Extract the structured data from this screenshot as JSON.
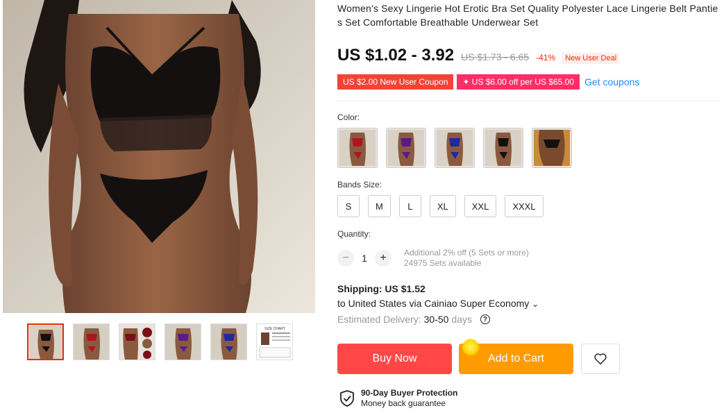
{
  "product": {
    "title": "Women's Sexy Lingerie Hot Erotic Bra Set Quality Polyester Lace Lingerie Belt Panties Set Comfortable Breathable Underwear Set"
  },
  "gallery": {
    "thumbnail_count": 6,
    "active_index": 0,
    "size_chart_label": "SIZE CHART"
  },
  "price": {
    "current": "US $1.02 - 3.92",
    "original": "US $1.73 - 6.65",
    "discount": "-41%",
    "deal_badge": "New User Deal"
  },
  "coupons": {
    "coupon1": "US $2.00 New User Coupon",
    "coupon2": "✦ US $6.00 off per US $65.00",
    "get_link": "Get coupons"
  },
  "color": {
    "label": "Color:",
    "swatches": [
      "red",
      "purple",
      "blue",
      "black",
      "photo"
    ]
  },
  "size": {
    "label": "Bands Size:",
    "options": [
      "S",
      "M",
      "L",
      "XL",
      "XXL",
      "XXXL"
    ]
  },
  "quantity": {
    "label": "Quantity:",
    "value": "1",
    "minus": "−",
    "plus": "+",
    "promo": "Additional 2% off (5 Sets or more)",
    "available": "24975 Sets available"
  },
  "shipping": {
    "cost": "Shipping: US $1.52",
    "route": "to United States via Cainiao Super Economy",
    "route_chevron": "⌄",
    "delivery_label": "Estimated Delivery:",
    "delivery_days": "30-50",
    "delivery_unit": "days",
    "help_icon_text": "?"
  },
  "actions": {
    "buy_now": "Buy Now",
    "add_to_cart": "Add to Cart"
  },
  "protection": {
    "title": "90-Day Buyer Protection",
    "subtitle": "Money back guarantee"
  },
  "colors": {
    "accent_red": "#ff4747",
    "accent_orange": "#ff9b00",
    "link_blue": "#1a8dff",
    "coupon_red": "#f44336",
    "coupon_pink": "#ff2e66"
  }
}
